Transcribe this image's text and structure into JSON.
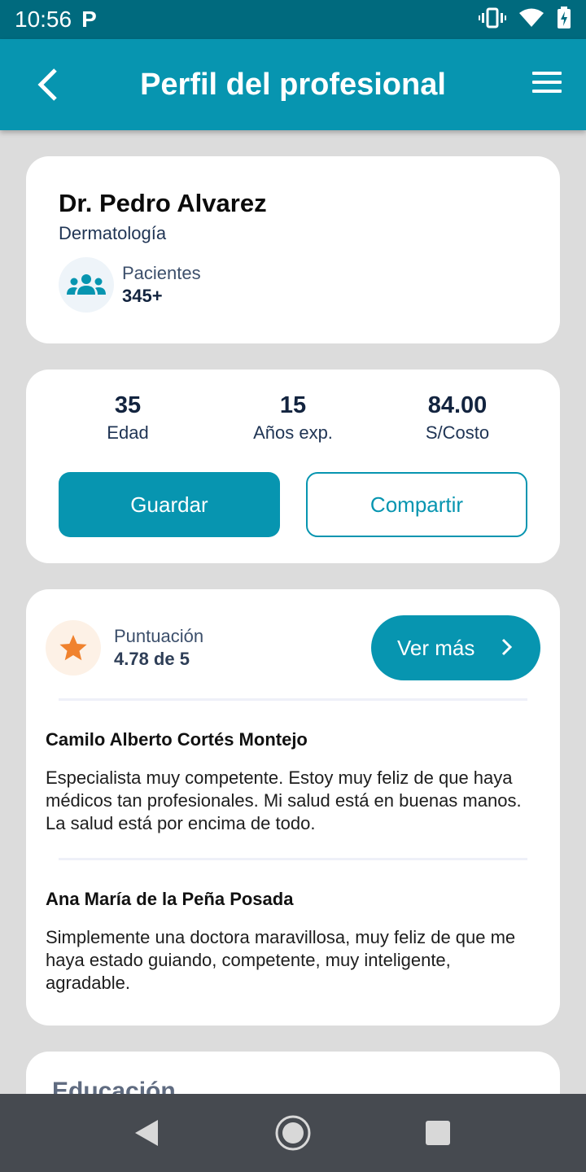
{
  "status_bar": {
    "time": "10:56",
    "notification_icon": "P"
  },
  "app_bar": {
    "title": "Perfil del profesional"
  },
  "profile": {
    "name": "Dr. Pedro Alvarez",
    "specialty": "Dermatología",
    "patients_label": "Pacientes",
    "patients_value": "345+"
  },
  "stats": {
    "age": {
      "value": "35",
      "label": "Edad"
    },
    "experience": {
      "value": "15",
      "label": "Años exp."
    },
    "cost": {
      "value": "84.00",
      "label": "S/Costo"
    },
    "save_label": "Guardar",
    "share_label": "Compartir"
  },
  "rating": {
    "label": "Puntuación",
    "value": "4.78 de 5",
    "more_label": "Ver más"
  },
  "reviews": [
    {
      "author": "Camilo Alberto Cortés Montejo",
      "text": "Especialista muy competente. Estoy muy feliz de que haya médicos tan profesionales. Mi salud está en buenas manos. La salud está por encima de todo."
    },
    {
      "author": "Ana María de la Peña Posada",
      "text": "Simplemente una doctora maravillosa, muy feliz de que me haya estado guiando, competente, muy inteligente, agradable."
    }
  ],
  "education": {
    "heading": "Educación"
  },
  "colors": {
    "primary": "#0795b0",
    "status_bar": "#006a7e",
    "star": "#f0822e"
  }
}
